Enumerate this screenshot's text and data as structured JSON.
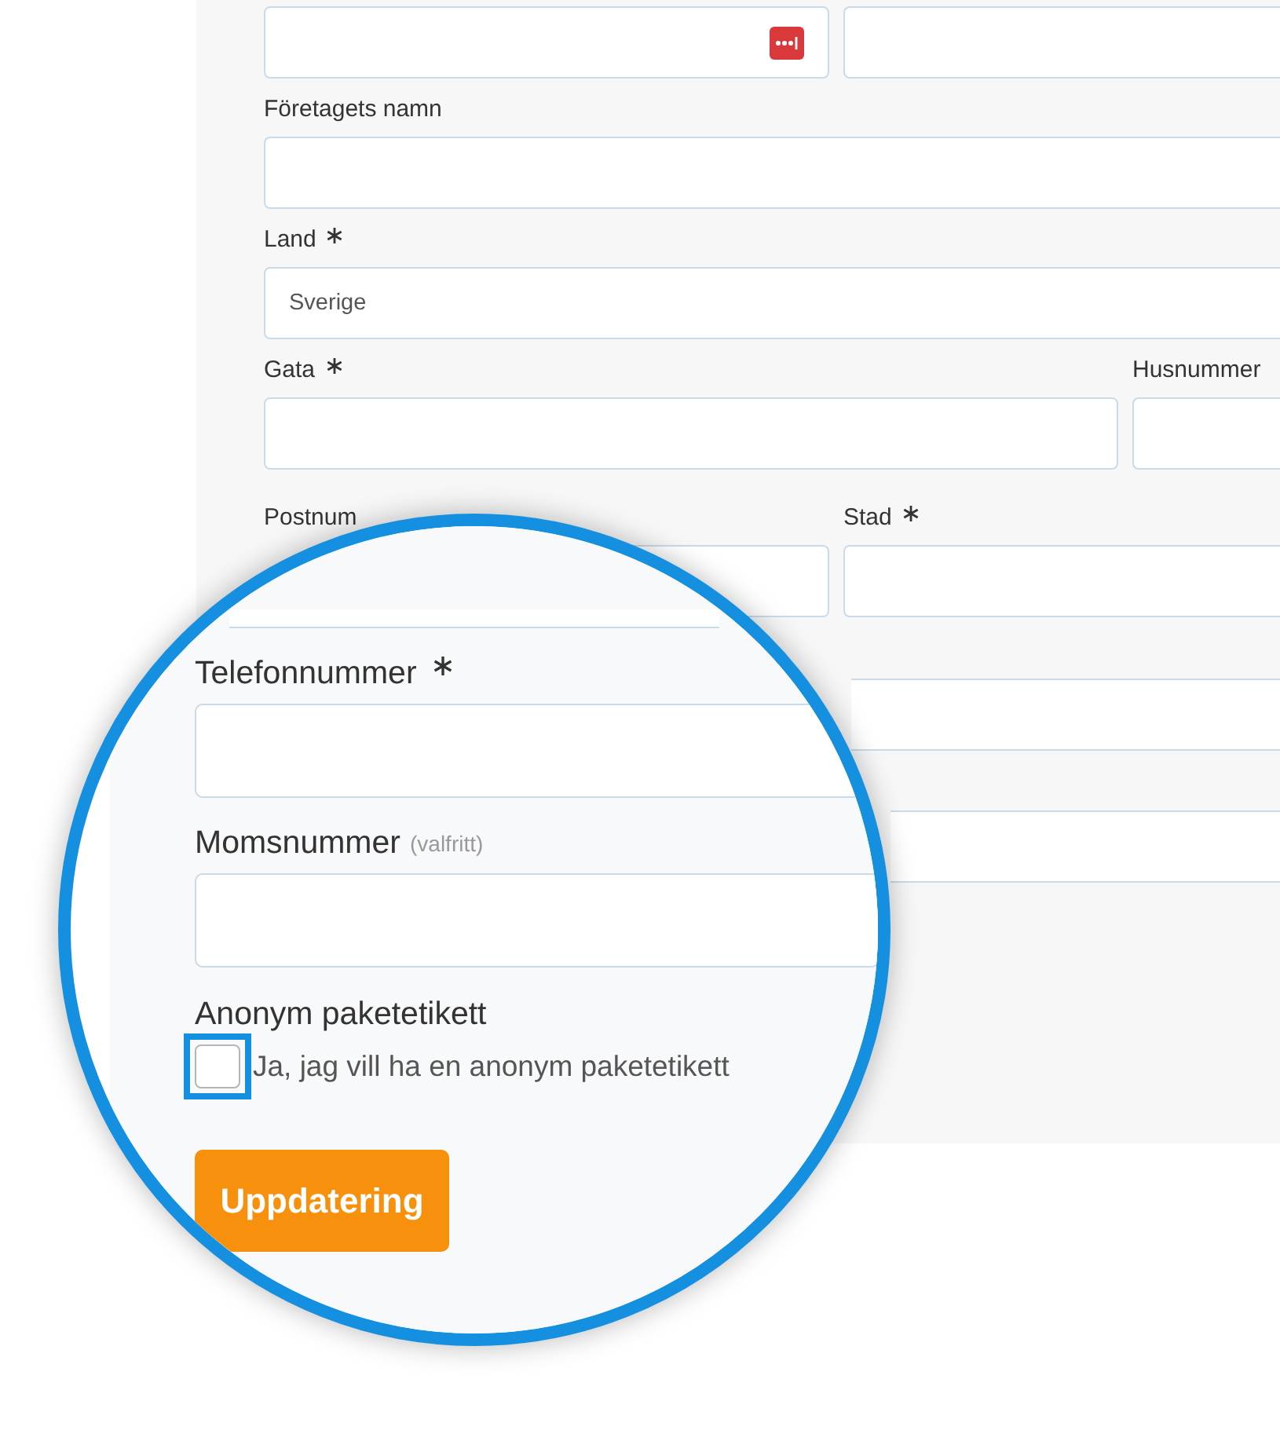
{
  "background_form": {
    "rows": [
      {
        "fields": [
          {
            "kind": "password"
          },
          {
            "kind": "text"
          }
        ]
      },
      {
        "fields": [
          {
            "kind": "text",
            "label": "Företagets namn",
            "required": false
          }
        ]
      },
      {
        "fields": [
          {
            "kind": "text",
            "label": "Land",
            "required": true,
            "value": "Sverige"
          }
        ]
      },
      {
        "fields": [
          {
            "kind": "text",
            "label": "Gata",
            "required": true
          },
          {
            "kind": "text",
            "label": "Husnummer",
            "required": false
          }
        ]
      },
      {
        "fields": [
          {
            "kind": "text",
            "label": "Postnum"
          },
          {
            "kind": "text",
            "label": "Stad",
            "required": true
          }
        ]
      },
      {
        "fields": [
          {
            "kind": "text"
          }
        ]
      },
      {
        "fields": [
          {
            "kind": "text"
          }
        ]
      }
    ]
  },
  "magnifier": {
    "fields": [
      {
        "label": "Telefonnummer",
        "required": true
      },
      {
        "label": "Momsnummer",
        "required": false,
        "hint": "(valfritt)"
      }
    ],
    "option": {
      "title": "Anonym paketetikett",
      "checkbox": {
        "label": "Ja, jag vill ha en anonym paketetikett",
        "checked": false,
        "highlighted": true
      }
    },
    "button": "Uppdatering"
  }
}
